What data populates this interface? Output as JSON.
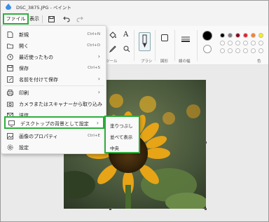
{
  "window": {
    "title": "DSC_3875.JPG - ペイント"
  },
  "menubar": {
    "file": "ファイル",
    "view": "表示"
  },
  "ribbon": {
    "tools_label": "ツール",
    "brushes_label": "ブラシ",
    "shapes_label": "図形",
    "size_label": "線の幅",
    "colors_label": "色",
    "text_tool": "A"
  },
  "file_menu": {
    "items": [
      {
        "label": "新規",
        "shortcut": "Ctrl+N"
      },
      {
        "label": "開く",
        "shortcut": "Ctrl+O"
      },
      {
        "label": "最近使ったもの",
        "shortcut": ""
      },
      {
        "label": "保存",
        "shortcut": "Ctrl+S"
      },
      {
        "label": "名前を付けて保存",
        "shortcut": ""
      },
      {
        "label": "印刷",
        "shortcut": ""
      },
      {
        "label": "カメラまたはスキャナーから取り込み",
        "shortcut": ""
      },
      {
        "label": "送信",
        "shortcut": ""
      },
      {
        "label": "デスクトップの背景として設定",
        "shortcut": ""
      },
      {
        "label": "画像のプロパティ",
        "shortcut": "Ctrl+E"
      },
      {
        "label": "設定",
        "shortcut": ""
      }
    ]
  },
  "submenu": {
    "items": [
      "塗りつぶし",
      "並べて表示",
      "中央"
    ]
  },
  "colors": {
    "primary": "#000000",
    "secondary": "#ffffff",
    "palette": [
      "#000000",
      "#7f7f7f",
      "#880015",
      "#ed1c24",
      "#ff7f27",
      "#fff200",
      "#22b14c"
    ],
    "highlight": "#2fad3d"
  }
}
